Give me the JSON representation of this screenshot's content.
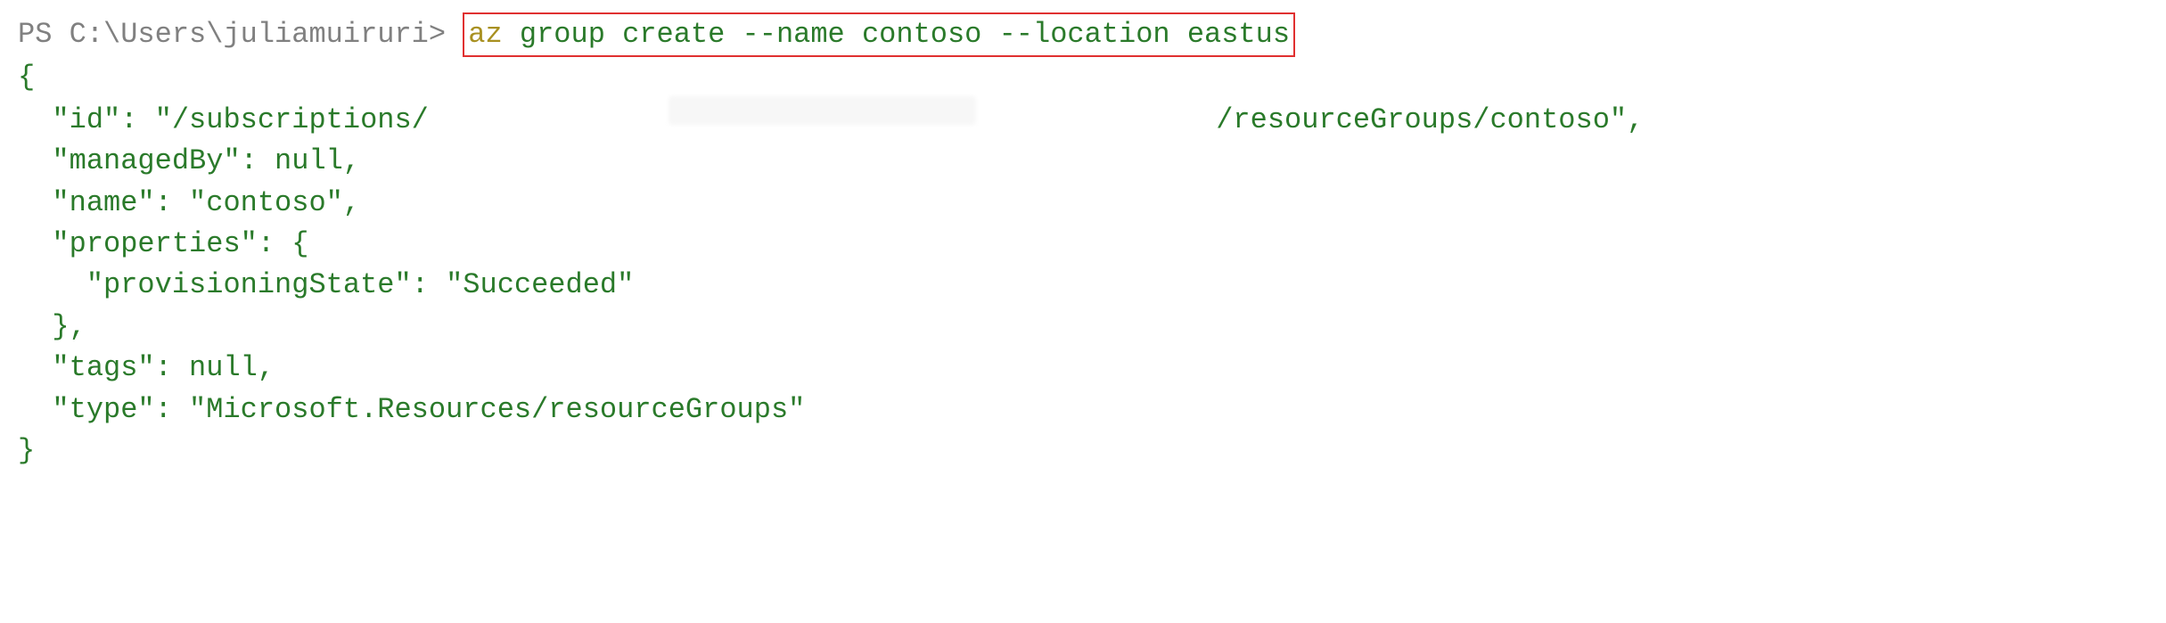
{
  "prompt": {
    "shell": "PS",
    "path": "C:\\Users\\juliamuiruri",
    "symbol": ">"
  },
  "command": {
    "executable": "az",
    "subcommand": "group create",
    "flag_name": "--name",
    "value_name": "contoso",
    "flag_location": "--location",
    "value_location": "eastus"
  },
  "output": {
    "brace_open": "{",
    "id_key": "\"id\":",
    "id_prefix": "\"/subscriptions/",
    "id_suffix": "/resourceGroups/contoso\",",
    "managedBy": "\"managedBy\": null,",
    "name": "\"name\": \"contoso\",",
    "properties_open": "\"properties\": {",
    "provisioningState": "\"provisioningState\": \"Succeeded\"",
    "properties_close": "},",
    "tags": "\"tags\": null,",
    "type": "\"type\": \"Microsoft.Resources/resourceGroups\"",
    "brace_close": "}"
  }
}
